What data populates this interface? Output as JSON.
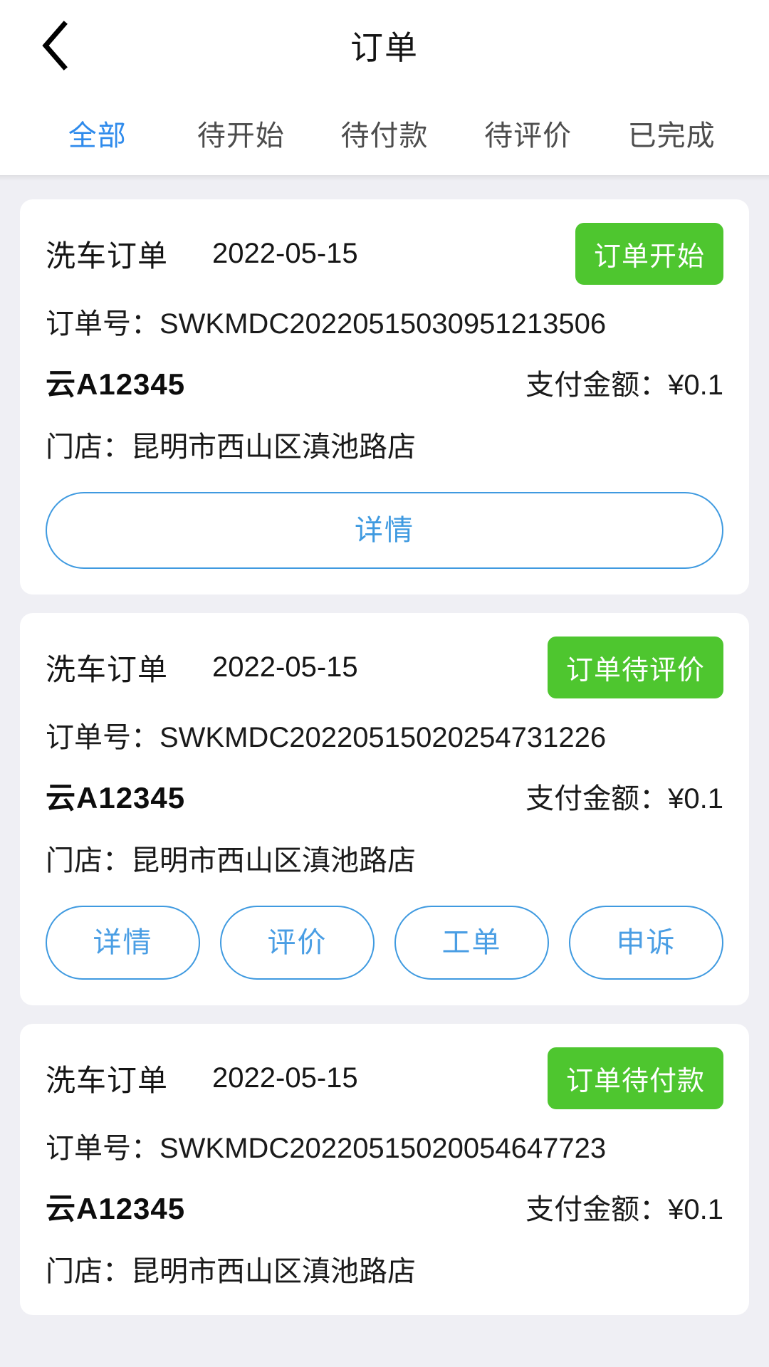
{
  "header": {
    "back_icon": "chevron-left-icon",
    "title": "订单"
  },
  "tabs": [
    {
      "label": "全部",
      "active": true
    },
    {
      "label": "待开始",
      "active": false
    },
    {
      "label": "待付款",
      "active": false
    },
    {
      "label": "待评价",
      "active": false
    },
    {
      "label": "已完成",
      "active": false
    }
  ],
  "labels": {
    "order_no_prefix": "订单号：",
    "amount_prefix": "支付金额：",
    "store_prefix": "门店：",
    "currency": "¥"
  },
  "colors": {
    "accent_blue": "#2f8bec",
    "button_blue": "#3f9ae0",
    "status_green": "#4ec62f",
    "page_bg": "#efeff4",
    "card_bg": "#ffffff",
    "text_primary": "#1a1a1a",
    "text_muted": "#4d4d4d"
  },
  "orders": [
    {
      "type": "洗车订单",
      "date": "2022-05-15",
      "status": "订单开始",
      "order_no_line": "订单号：SWKMDC20220515030951213506",
      "order_no": "SWKMDC20220515030951213506",
      "plate": "云A12345",
      "amount_line": "支付金额：¥0.1",
      "amount": "0.1",
      "store_line": "门店：昆明市西山区滇池路店",
      "store": "昆明市西山区滇池路店",
      "actions": [
        {
          "label": "详情"
        }
      ]
    },
    {
      "type": "洗车订单",
      "date": "2022-05-15",
      "status": "订单待评价",
      "order_no_line": "订单号：SWKMDC20220515020254731226",
      "order_no": "SWKMDC20220515020254731226",
      "plate": "云A12345",
      "amount_line": "支付金额：¥0.1",
      "amount": "0.1",
      "store_line": "门店：昆明市西山区滇池路店",
      "store": "昆明市西山区滇池路店",
      "actions": [
        {
          "label": "详情"
        },
        {
          "label": "评价"
        },
        {
          "label": "工单"
        },
        {
          "label": "申诉"
        }
      ]
    },
    {
      "type": "洗车订单",
      "date": "2022-05-15",
      "status": "订单待付款",
      "order_no_line": "订单号：SWKMDC20220515020054647723",
      "order_no": "SWKMDC20220515020054647723",
      "plate": "云A12345",
      "amount_line": "支付金额：¥0.1",
      "amount": "0.1",
      "store_line": "门店：昆明市西山区滇池路店",
      "store": "昆明市西山区滇池路店",
      "actions": []
    }
  ]
}
